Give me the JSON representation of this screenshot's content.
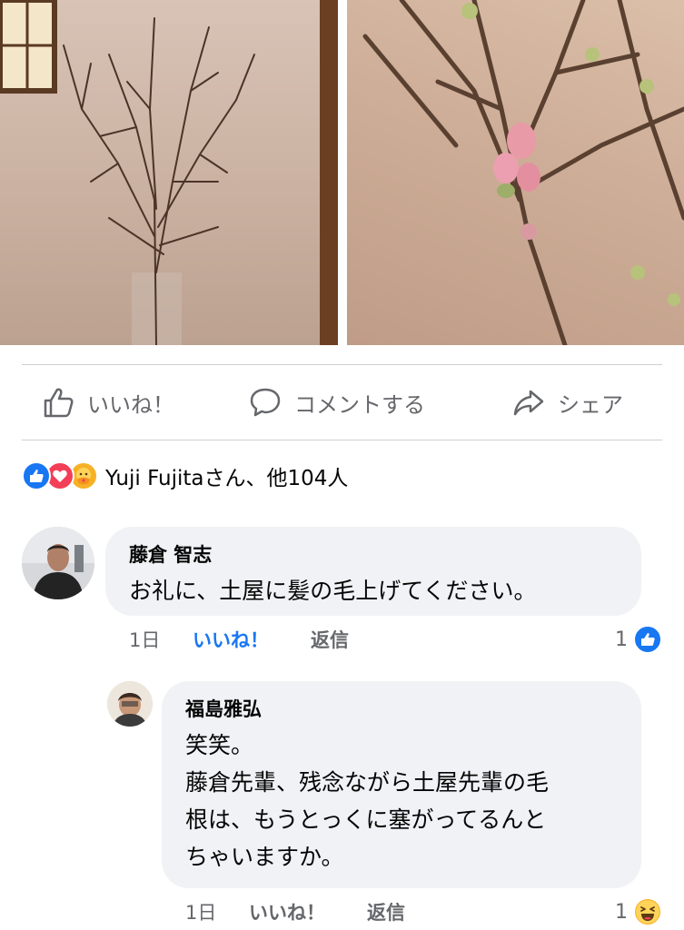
{
  "post_photos": {
    "left_photo": "branches-in-vase-photo",
    "right_photo": "cherry-blossom-buds-photo"
  },
  "action_bar": {
    "like_label": "いいね！",
    "comment_label": "コメントする",
    "share_label": "シェア"
  },
  "reactions": {
    "icons": [
      "like",
      "love",
      "care"
    ],
    "summary": "Yuji Fujitaさん、他104人"
  },
  "comments": [
    {
      "author": "藤倉 智志",
      "text": "お礼に、土屋に髪の毛上げてください。",
      "time": "1日",
      "like_label": "いいね！",
      "reply_label": "返信",
      "reaction_count": "1",
      "reaction_icon": "like",
      "liked": true
    },
    {
      "author": "福島雅弘",
      "lines": [
        "笑笑。",
        "藤倉先輩、残念ながら土屋先輩の毛",
        "根は、もうとっくに塞がってるんと",
        "ちゃいますか。"
      ],
      "time": "1日",
      "like_label": "いいね！",
      "reply_label": "返信",
      "reaction_count": "1",
      "reaction_icon": "haha",
      "liked": false
    }
  ],
  "colors": {
    "accent": "#1877f2",
    "muted_text": "#65676b",
    "bubble_bg": "#f0f2f5",
    "divider": "#ced0d4"
  }
}
